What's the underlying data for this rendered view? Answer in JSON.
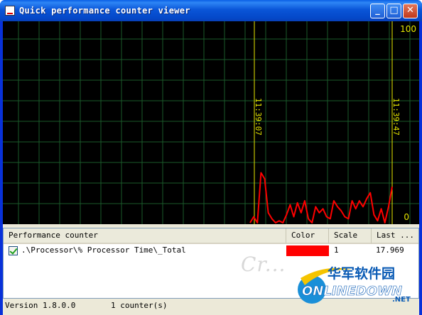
{
  "window": {
    "title": "Quick performance counter viewer",
    "buttons": {
      "minimize": "_",
      "maximize": "□",
      "close": "✕"
    }
  },
  "graph": {
    "scale_max_label": "100",
    "scale_min_label": "0",
    "time_markers": [
      "11:39:07",
      "11:39:47"
    ],
    "colors": {
      "background": "#000000",
      "grid": "#1a5a2a",
      "marker": "#e8e800",
      "line": "#ff0000"
    }
  },
  "chart_data": {
    "type": "line",
    "ylim": [
      0,
      100
    ],
    "x_markers": [
      "11:39:07",
      "11:39:47"
    ],
    "series": [
      {
        "name": ".\\Processor\\% Processor Time\\_Total",
        "color": "#ff0000",
        "values": [
          0,
          3,
          0,
          25,
          22,
          5,
          2,
          0,
          1,
          0,
          4,
          9,
          3,
          10,
          5,
          11,
          2,
          0,
          8,
          5,
          7,
          3,
          2,
          11,
          8,
          6,
          3,
          2,
          11,
          7,
          11,
          8,
          12,
          15,
          4,
          1,
          7,
          0,
          8,
          18
        ]
      }
    ]
  },
  "counter_list": {
    "headers": [
      "Performance counter",
      "Color",
      "Scale",
      "Last ..."
    ],
    "rows": [
      {
        "checked": true,
        "counter": ".\\Processor\\% Processor Time\\_Total",
        "color": "#ff0000",
        "scale": "1",
        "last": "17.969"
      }
    ]
  },
  "status": {
    "version": "Version 1.8.0.0",
    "counters": "1 counter(s)"
  },
  "watermark": {
    "site_cn": "华军软件园",
    "site_en": "ONLINEDOWN",
    "site_tld": ".NET"
  }
}
